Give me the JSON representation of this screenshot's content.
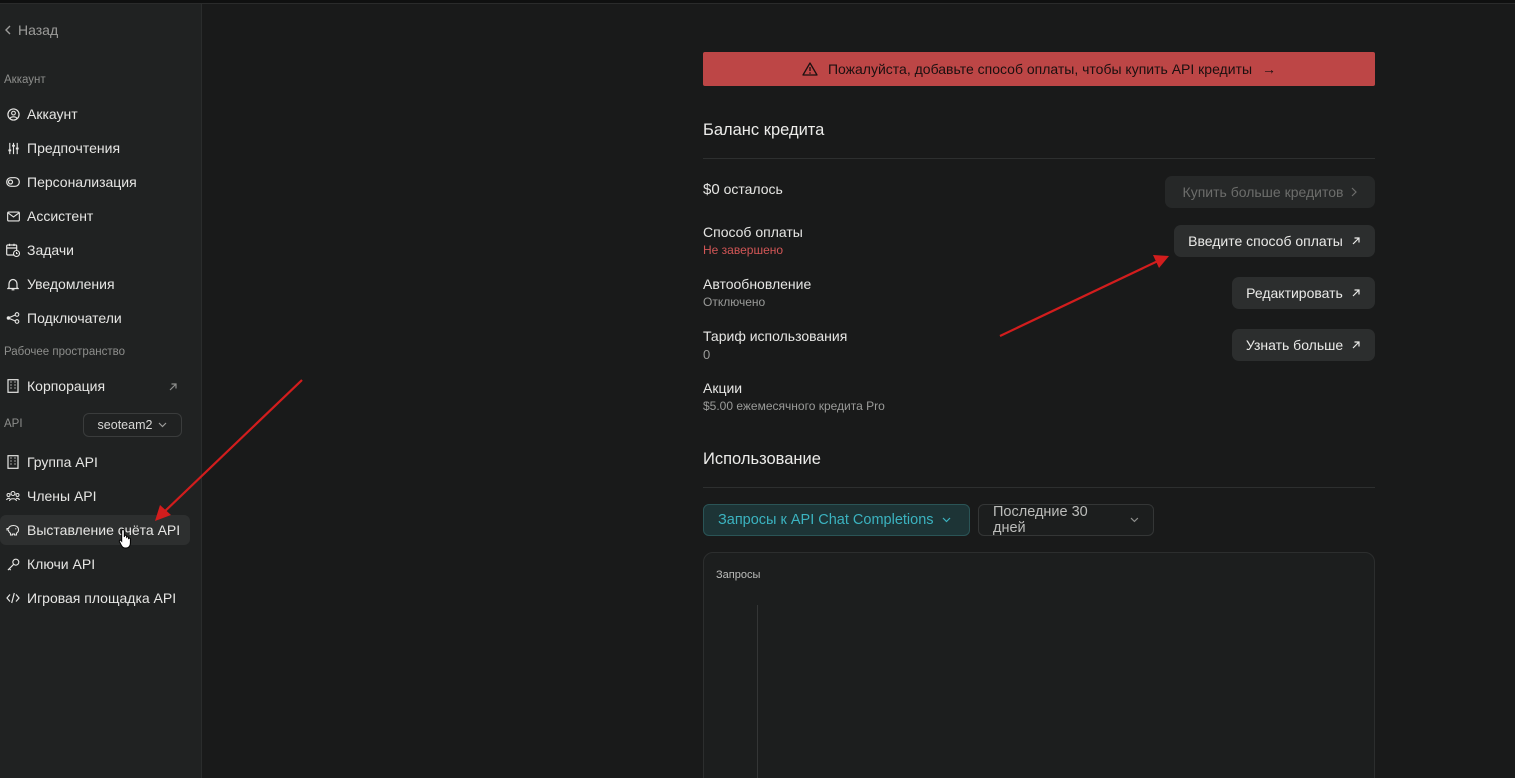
{
  "sidebar": {
    "back_label": "Назад",
    "account_section": "Аккаунт",
    "items": [
      {
        "label": "Аккаунт",
        "icon": "user-circle-icon"
      },
      {
        "label": "Предпочтения",
        "icon": "sliders-icon"
      },
      {
        "label": "Персонализация",
        "icon": "toggle-icon"
      },
      {
        "label": "Ассистент",
        "icon": "mail-icon"
      },
      {
        "label": "Задачи",
        "icon": "calendar-clock-icon"
      },
      {
        "label": "Уведомления",
        "icon": "bell-icon"
      },
      {
        "label": "Подключатели",
        "icon": "connectors-icon"
      }
    ],
    "workspace_section": "Рабочее пространство",
    "workspace_item": {
      "label": "Корпорация",
      "icon": "building-icon"
    },
    "api_section": "API",
    "api_team": "seoteam2",
    "api_items": [
      {
        "label": "Группа API",
        "icon": "building-icon"
      },
      {
        "label": "Члены API",
        "icon": "users-icon"
      },
      {
        "label": "Выставление счёта API",
        "icon": "piggy-bank-icon",
        "active": true
      },
      {
        "label": "Ключи API",
        "icon": "key-icon"
      },
      {
        "label": "Игровая площадка API",
        "icon": "code-icon"
      }
    ]
  },
  "banner": {
    "text": "Пожалуйста, добавьте способ оплаты, чтобы купить API кредиты",
    "arrow": "→",
    "color": "#bd4646"
  },
  "credit": {
    "title": "Баланс кредита",
    "balance_amount": "$0",
    "balance_suffix": "осталось",
    "buy_button": "Купить больше кредитов",
    "payment_title": "Способ оплаты",
    "payment_status": "Не завершено",
    "payment_button": "Введите способ оплаты",
    "autorenew_title": "Автообновление",
    "autorenew_status": "Отключено",
    "autorenew_button": "Редактировать",
    "tier_title": "Тариф использования",
    "tier_value": "0",
    "tier_button": "Узнать больше",
    "promo_title": "Акции",
    "promo_value": "$5.00 ежемесячного кредита Pro"
  },
  "usage": {
    "title": "Использование",
    "metric_select": "Запросы к API Chat Completions",
    "range_select": "Последние 30 дней",
    "chart_ylabel": "Запросы",
    "accent": "#3bb3c0"
  }
}
